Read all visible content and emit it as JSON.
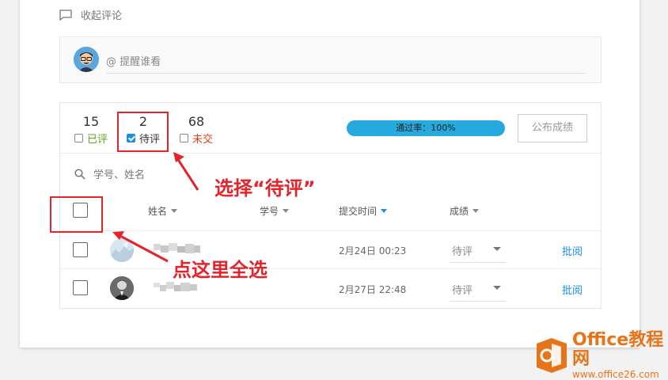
{
  "comments": {
    "collapse_label": "收起评论",
    "mention_placeholder": "@ 提醒谁看"
  },
  "stats": [
    {
      "count": "15",
      "label": "已评",
      "checked": false,
      "color": "#5aa61d"
    },
    {
      "count": "2",
      "label": "待评",
      "checked": true,
      "color": "#333333"
    },
    {
      "count": "68",
      "label": "未交",
      "checked": false,
      "color": "#e0401f"
    }
  ],
  "pass_rate": {
    "text": "通过率：100%",
    "fraction": 1.0
  },
  "publish_label": "公布成绩",
  "search_placeholder": "学号、姓名",
  "columns": {
    "name": "姓名",
    "student_id": "学号",
    "submit_time": "提交时间",
    "grade": "成绩"
  },
  "rows": [
    {
      "submit_time": "2月24日 00:23",
      "grade": "待评",
      "action": "批阅"
    },
    {
      "submit_time": "2月27日 22:48",
      "grade": "待评",
      "action": "批阅"
    }
  ],
  "annotations": {
    "select_pending": "选择“待评”",
    "select_all": "点这里全选"
  },
  "watermark": {
    "title": "Office教程网",
    "url": "www.office26.com"
  },
  "colors": {
    "accent": "#1a8fe0",
    "annotation": "#e3242b",
    "progress": "#26a9dc"
  }
}
